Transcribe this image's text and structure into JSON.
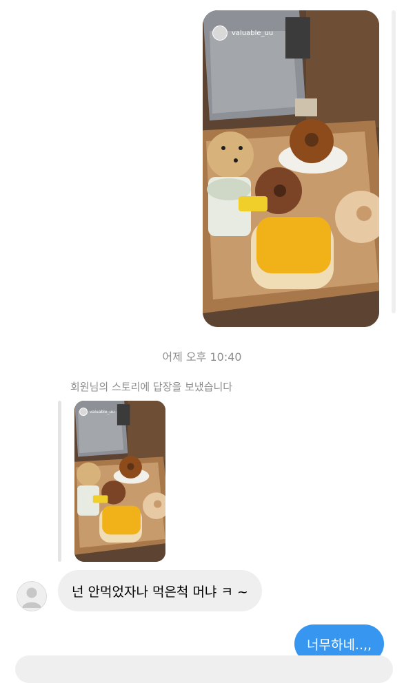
{
  "story": {
    "username": "valuable_uu"
  },
  "thread": {
    "timestamp": "어제 오후 10:40",
    "reply_note": "회원님의 스토리에 답장을 보냈습니다"
  },
  "messages": [
    {
      "direction": "incoming",
      "text": "넌 안먹었자나 먹은척 머냐 ㅋ ~"
    },
    {
      "direction": "outgoing",
      "text": "너무하네..,,"
    }
  ],
  "colors": {
    "outgoing_bubble": "#3797f0",
    "incoming_bubble": "#efefef",
    "meta_text": "#8e8e8e"
  },
  "icons": {
    "user_avatar": "default-profile-icon"
  }
}
